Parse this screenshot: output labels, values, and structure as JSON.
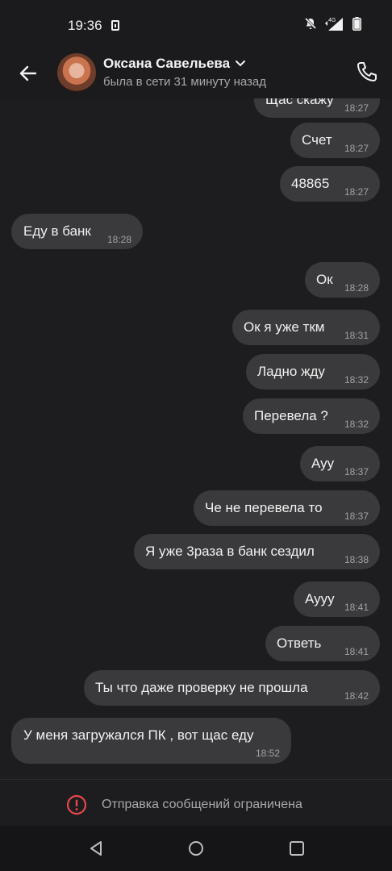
{
  "status_bar": {
    "time": "19:36",
    "network": "4G"
  },
  "header": {
    "contact_name": "Оксана Савельева",
    "last_seen": "была в сети 31 минуту назад"
  },
  "messages": [
    {
      "text": "Щас скажу",
      "time": "18:27",
      "dir": "out"
    },
    {
      "text": "Счет",
      "time": "18:27",
      "dir": "out"
    },
    {
      "text": "48865",
      "time": "18:27",
      "dir": "out"
    },
    {
      "text": "Еду в банк",
      "time": "18:28",
      "dir": "in"
    },
    {
      "text": "Ок",
      "time": "18:28",
      "dir": "out"
    },
    {
      "text": "Ок я уже ткм",
      "time": "18:31",
      "dir": "out"
    },
    {
      "text": "Ладно жду",
      "time": "18:32",
      "dir": "out"
    },
    {
      "text": "Перевела ?",
      "time": "18:32",
      "dir": "out"
    },
    {
      "text": "Ауу",
      "time": "18:37",
      "dir": "out"
    },
    {
      "text": "Че не перевела то",
      "time": "18:37",
      "dir": "out"
    },
    {
      "text": "Я уже 3раза в банк сездил",
      "time": "18:38",
      "dir": "out"
    },
    {
      "text": "Аууу",
      "time": "18:41",
      "dir": "out"
    },
    {
      "text": "Ответь",
      "time": "18:41",
      "dir": "out"
    },
    {
      "text": "Ты что даже проверку не прошла",
      "time": "18:42",
      "dir": "out"
    },
    {
      "text": "У меня загружался ПК , вот щас еду",
      "time": "18:52",
      "dir": "in"
    }
  ],
  "bottom": {
    "restriction_text": "Отправка сообщений ограничена"
  },
  "colors": {
    "background": "#1d1d1f",
    "bubble": "#3a3a3d",
    "warning": "#e8474c"
  }
}
